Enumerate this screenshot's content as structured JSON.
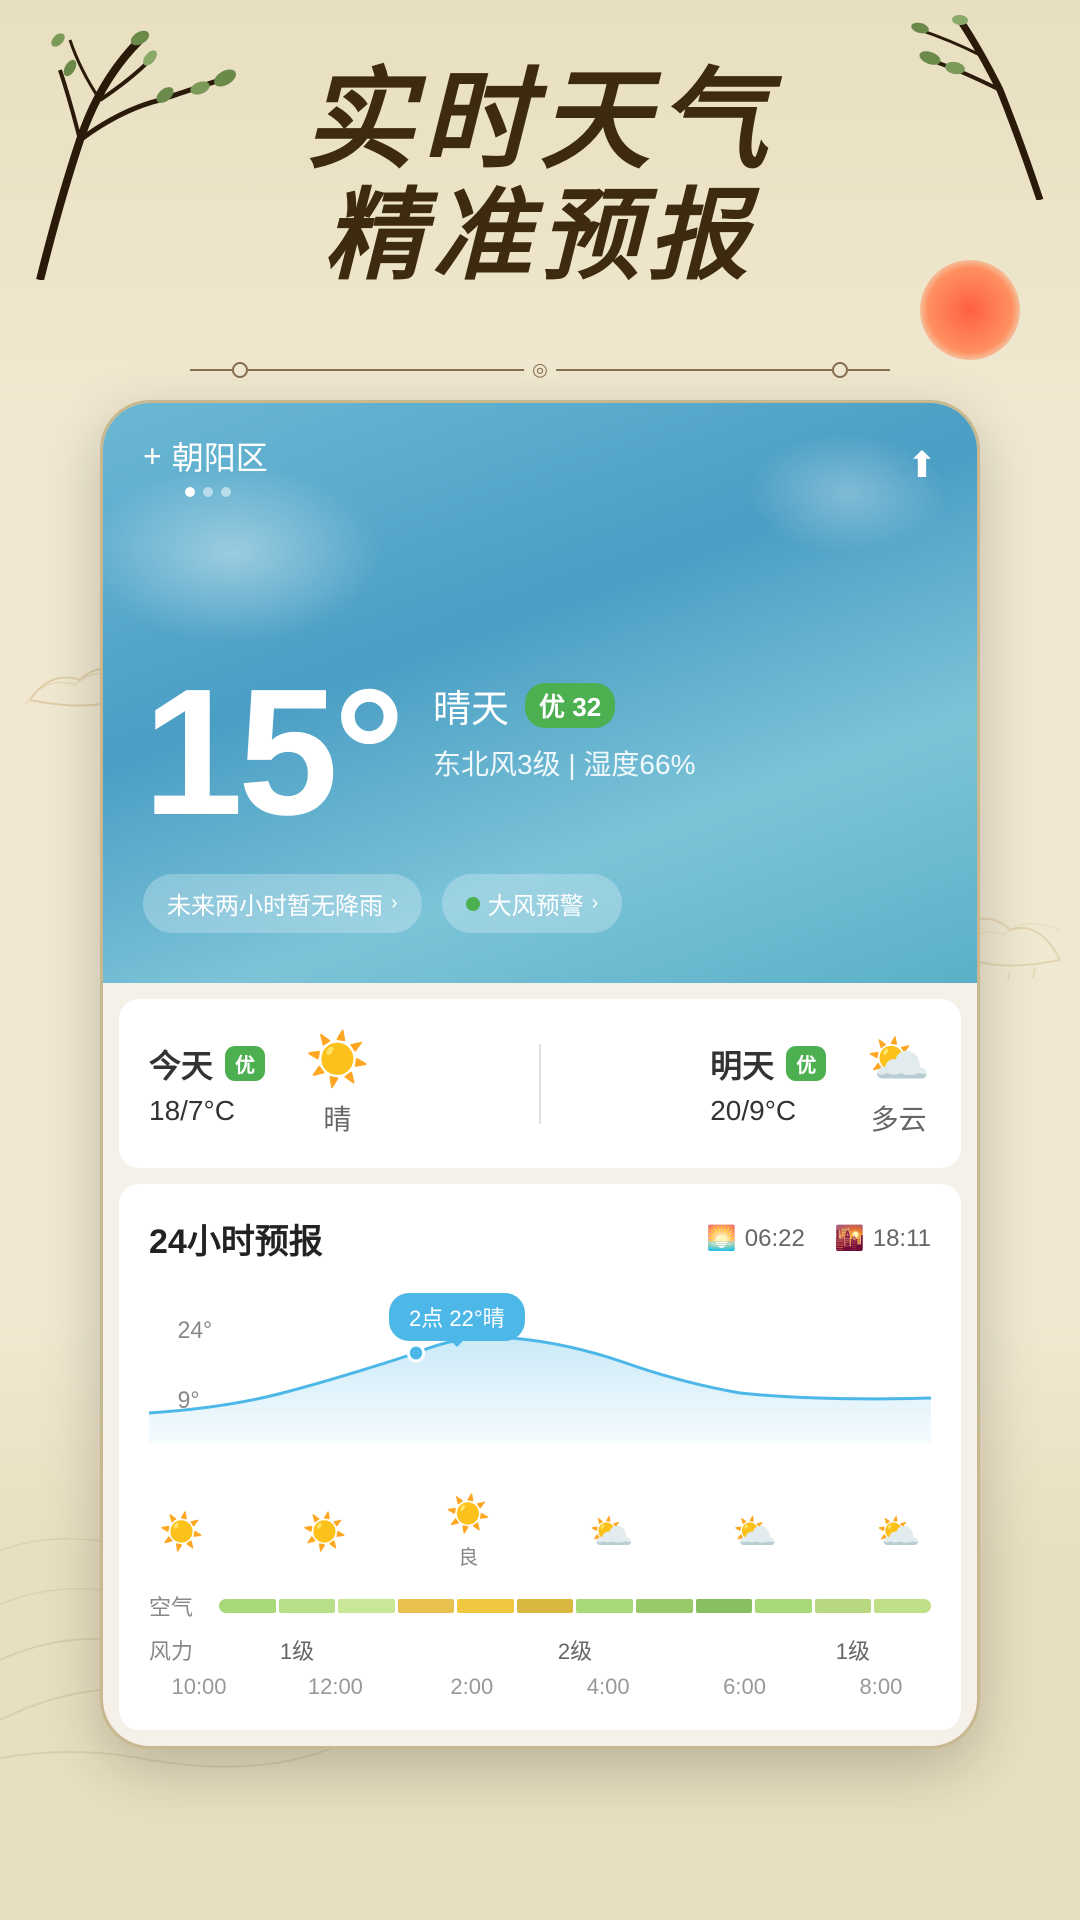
{
  "hero": {
    "line1": "实时天气",
    "line2": "精准预报"
  },
  "location": {
    "name": "朝阳区",
    "plus": "+",
    "share": "⬆"
  },
  "weather": {
    "temperature": "15°",
    "condition": "晴天",
    "aqi_value": "优 32",
    "wind": "东北风3级",
    "humidity": "湿度66%",
    "alert1": "未来两小时暂无降雨",
    "alert2": "大风预警"
  },
  "daily": [
    {
      "label": "今天",
      "aqi": "优",
      "temp": "18/7°C",
      "condition": "晴",
      "icon": "☀️"
    },
    {
      "label": "明天",
      "aqi": "优",
      "temp": "20/9°C",
      "condition": "多云",
      "icon": "⛅"
    }
  ],
  "hourly": {
    "title": "24小时预报",
    "sunrise": "06:22",
    "sunset": "18:11",
    "tooltip": "2点 22°晴",
    "temps": {
      "high": "24°",
      "low": "9°"
    },
    "hours": [
      "10:00",
      "12:00",
      "2:00",
      "4:00",
      "6:00",
      "8:00"
    ],
    "icons": [
      "☀️",
      "☀️",
      "☀️",
      "⛅",
      "⛅",
      "⛅"
    ],
    "quality_labels": [
      "良",
      "",
      "",
      ""
    ],
    "air_quality_label": "空气",
    "wind_label": "风力",
    "wind_values": [
      "1级",
      "",
      "2级",
      "",
      "1级"
    ]
  },
  "colors": {
    "sky_start": "#6bb8d4",
    "sky_end": "#4a9ec4",
    "aqi_green": "#4CAF50",
    "card_bg": "#f5f0e8",
    "background": "#f0e8d0"
  }
}
